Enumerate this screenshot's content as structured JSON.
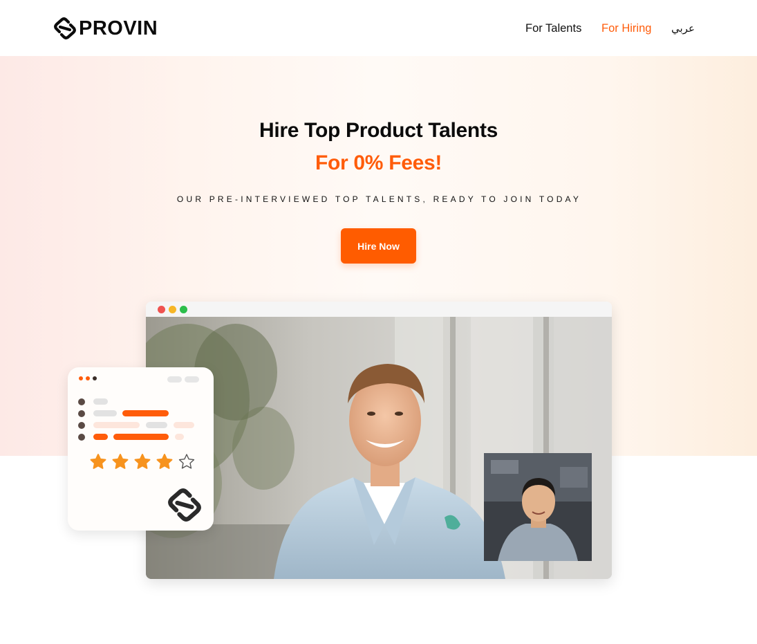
{
  "header": {
    "logo_text": "PROVIN",
    "nav": [
      {
        "label": "For Talents"
      },
      {
        "label": "For Hiring"
      },
      {
        "label": "عربي"
      }
    ]
  },
  "hero": {
    "title": "Hire Top Product Talents",
    "subtitle": "For 0% Fees!",
    "tagline": "OUR PRE-INTERVIEWED TOP TALENTS, READY TO JOIN TODAY",
    "cta_label": "Hire Now"
  },
  "rating_card": {
    "rating": 4,
    "max_rating": 5,
    "icons": [
      "star-filled-icon",
      "star-outline-icon",
      "provin-logo-icon"
    ]
  },
  "colors": {
    "accent": "#ff5c0a",
    "text": "#111111",
    "star": "#f7931e"
  }
}
